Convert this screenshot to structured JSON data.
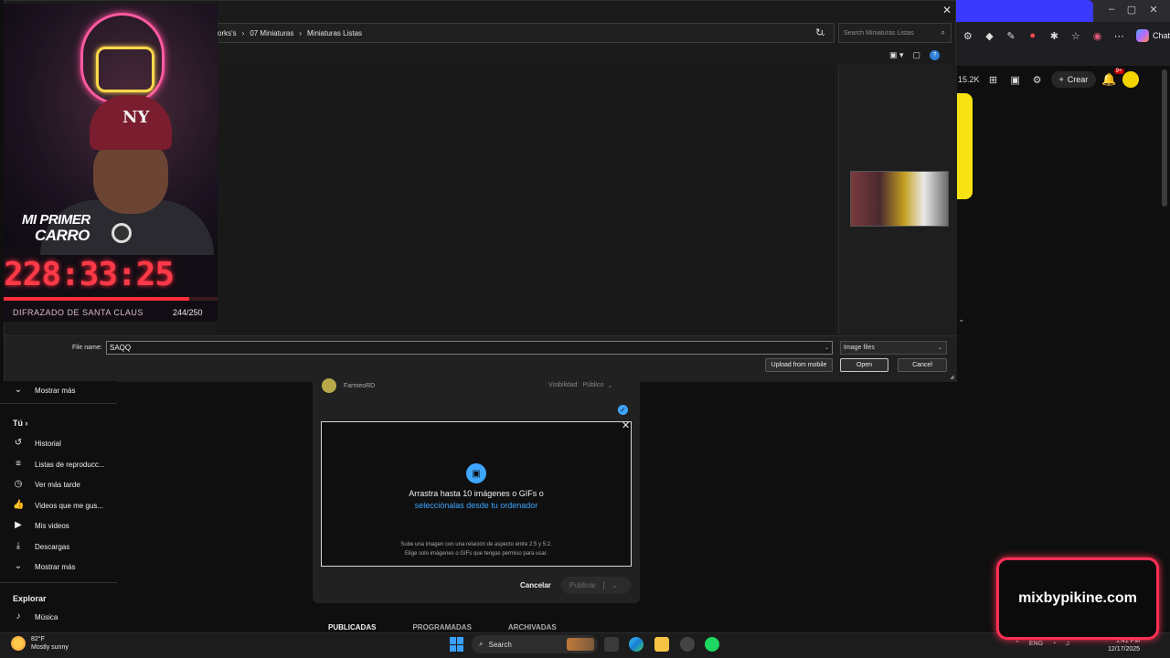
{
  "browser": {
    "chat_label": "Chat",
    "icons": [
      "extensions-icon",
      "diamond-icon",
      "pen-icon",
      "record-icon",
      "settings-icon",
      "favorites-icon",
      "profile-icon",
      "more-icon"
    ]
  },
  "yt_header": {
    "subscriber_count": "15.2K",
    "create_label": "Crear",
    "notification_badge": "9+"
  },
  "file_dialog": {
    "breadcrumb": [
      "orks's",
      "07 Miniaturas",
      "Miniaturas Listas"
    ],
    "search_placeholder": "Search Miniaturas Listas",
    "file_name_label": "File name:",
    "file_name_value": "SAQQ",
    "file_type": "Image files",
    "buttons": {
      "upload": "Upload from mobile",
      "open": "Open",
      "cancel": "Cancel"
    }
  },
  "overlay": {
    "badge_line1": "MI PRIMER",
    "badge_line2": "CARRO",
    "timer": "228:33:25",
    "goal_label": "DIFRAZADO DE SANTA CLAUS",
    "goal_count": "244/250",
    "goal_progress": 0.976,
    "cap_logo": "NY"
  },
  "sidebar": {
    "more_top": "Mostrar más",
    "you_heading": "Tú",
    "items": [
      {
        "label": "Historial",
        "icon": "history-icon"
      },
      {
        "label": "Listas de reproducc...",
        "icon": "playlists-icon"
      },
      {
        "label": "Ver más tarde",
        "icon": "watch-later-icon"
      },
      {
        "label": "Videos que me gus...",
        "icon": "liked-icon"
      },
      {
        "label": "Mis videos",
        "icon": "my-videos-icon"
      },
      {
        "label": "Descargas",
        "icon": "downloads-icon"
      },
      {
        "label": "Mostrar más",
        "icon": "chevron-down-icon"
      }
    ],
    "explore_heading": "Explorar",
    "music_label": "Música"
  },
  "upload": {
    "channel_name": "FarmeoRD",
    "visibility_label": "Visibilidad:",
    "visibility_value": "Público",
    "drop_title": "Arrastra hasta 10 imágenes o GIFs o",
    "drop_link": "selecciónalas desde tu ordenador",
    "note1": "Sube una imagen con una relación de aspecto entre 2:5 y 5:2.",
    "note2": "Elige solo imágenes o GIFs que tengas permiso para usar.",
    "cancel_label": "Cancelar",
    "publish_label": "Publicar",
    "tabs": [
      "PUBLICADAS",
      "PROGRAMADAS",
      "ARCHIVADAS"
    ]
  },
  "watermark": {
    "text": "mixbypikine.com"
  },
  "taskbar": {
    "temperature": "82°F",
    "weather": "Mostly sunny",
    "search_label": "Search",
    "language": "ENG",
    "time": "1:41 PM",
    "date": "12/17/2025"
  },
  "colors": {
    "accent_blue": "#3ea6ff",
    "timer_red": "#ff3a48",
    "neon_pink": "#ff2f55",
    "yt_yellow": "#f6e311"
  }
}
